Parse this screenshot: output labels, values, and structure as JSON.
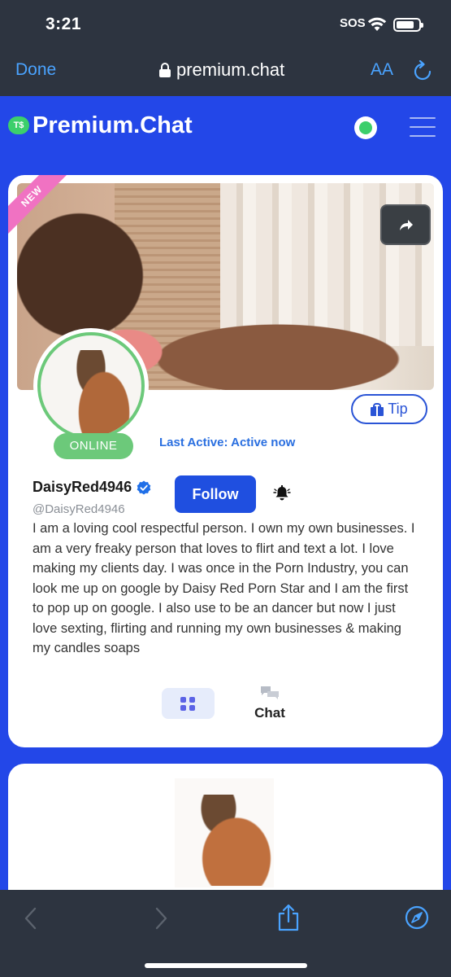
{
  "status_bar": {
    "time": "3:21",
    "sos": "SOS"
  },
  "browser": {
    "done_label": "Done",
    "url": "premium.chat",
    "text_size_label": "AA"
  },
  "header": {
    "brand_name": "Premium.Chat",
    "logo_text": "T$",
    "accent_color": "#2347e8",
    "online_color": "#3ccf6b"
  },
  "profile": {
    "ribbon": "NEW",
    "status_badge": "ONLINE",
    "tip_label": "Tip",
    "last_active_label": "Last Active:",
    "last_active_value": "Active now",
    "username": "DaisyRed4946",
    "handle": "@DaisyRed4946",
    "follow_label": "Follow",
    "bio": "I am a loving cool respectful person. I own my own businesses. I am a very freaky person that loves to flirt and text a lot. I love making my clients day. I was once in the Porn Industry, you can look me up on google by Daisy Red Porn Star and I am the first to pop up on google. I also use to be an dancer but now I just love sexting, flirting and running my own businesses & making my candles soaps",
    "tabs": {
      "chat_label": "Chat"
    }
  },
  "icons": {
    "wifi": "wifi-icon",
    "battery": "battery-icon",
    "lock": "lock-icon",
    "reload": "reload-icon",
    "menu": "menu-icon",
    "share": "share-icon",
    "gift": "gift-icon",
    "verified": "verified-icon",
    "bell": "bell-icon",
    "grid": "grid-icon",
    "chat": "chat-bubble-icon",
    "back": "chevron-left-icon",
    "forward": "chevron-right-icon",
    "share_toolbar": "share-toolbar-icon",
    "compass": "compass-icon"
  }
}
